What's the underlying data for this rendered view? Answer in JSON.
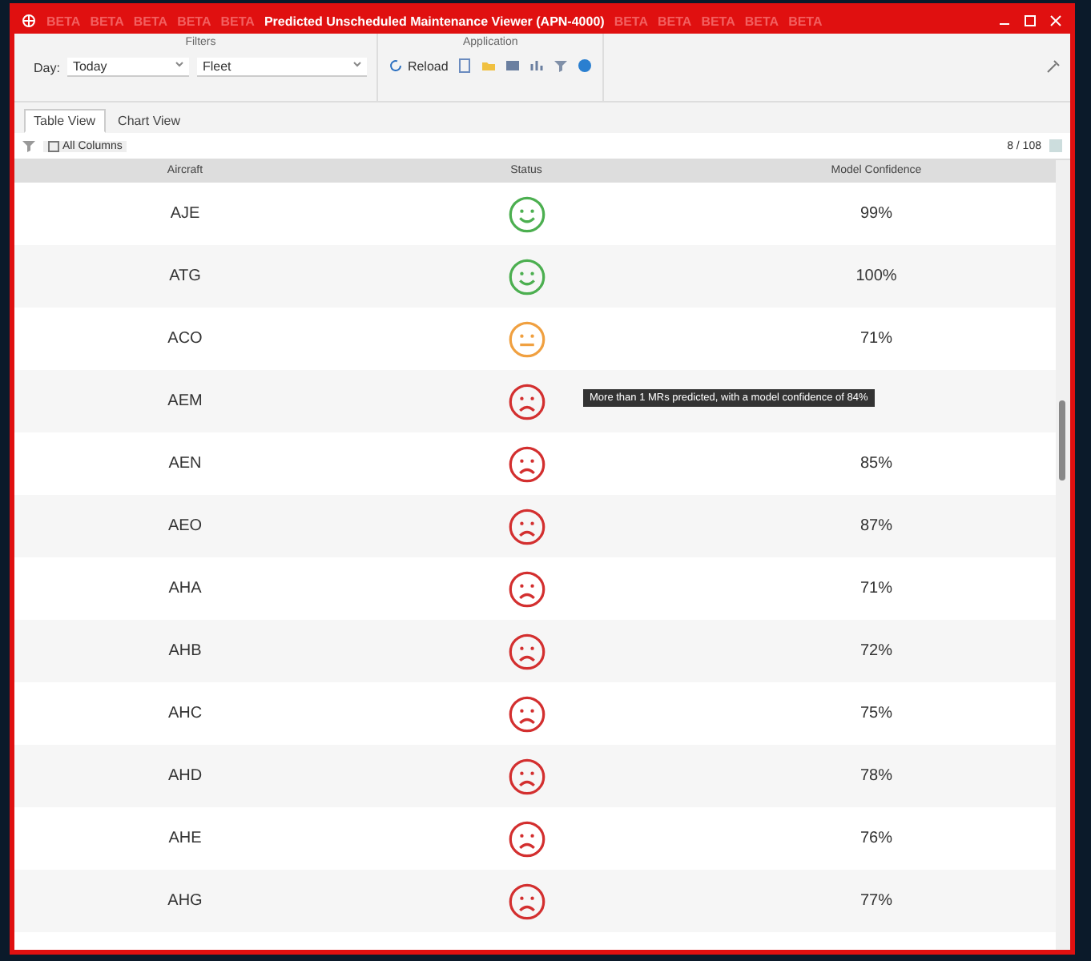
{
  "window": {
    "title": "Predicted Unscheduled Maintenance Viewer (APN-4000)",
    "beta_left": [
      "BETA",
      "BETA",
      "BETA",
      "BETA",
      "BETA"
    ],
    "beta_right": [
      "BETA",
      "BETA",
      "BETA",
      "BETA",
      "BETA"
    ]
  },
  "ribbon": {
    "groups": [
      {
        "label": "Filters"
      },
      {
        "label": "Application"
      }
    ],
    "day_label": "Day:",
    "day_value": "Today",
    "fleet_value": "Fleet",
    "reload_label": "Reload"
  },
  "tabs": [
    {
      "label": "Table View",
      "selected": true
    },
    {
      "label": "Chart View",
      "selected": false
    }
  ],
  "filter_bar": {
    "columns_label": "All Columns",
    "counter": "8 / 108"
  },
  "table": {
    "columns": [
      "Aircraft",
      "Status",
      "Model Confidence"
    ],
    "rows": [
      {
        "aircraft": "AJE",
        "kind": "happy",
        "color": "#4caf50",
        "confidence": "99%"
      },
      {
        "aircraft": "ATG",
        "kind": "happy",
        "color": "#4caf50",
        "confidence": "100%"
      },
      {
        "aircraft": "ACO",
        "kind": "neutral",
        "color": "#f0a040",
        "confidence": "71%"
      },
      {
        "aircraft": "AEM",
        "kind": "sad",
        "color": "#d32f2f",
        "tooltip": "More than 1 MRs predicted, with a model confidence of 84%"
      },
      {
        "aircraft": "AEN",
        "kind": "sad",
        "color": "#d32f2f",
        "confidence": "85%"
      },
      {
        "aircraft": "AEO",
        "kind": "sad",
        "color": "#d32f2f",
        "confidence": "87%"
      },
      {
        "aircraft": "AHA",
        "kind": "sad",
        "color": "#d32f2f",
        "confidence": "71%"
      },
      {
        "aircraft": "AHB",
        "kind": "sad",
        "color": "#d32f2f",
        "confidence": "72%"
      },
      {
        "aircraft": "AHC",
        "kind": "sad",
        "color": "#d32f2f",
        "confidence": "75%"
      },
      {
        "aircraft": "AHD",
        "kind": "sad",
        "color": "#d32f2f",
        "confidence": "78%"
      },
      {
        "aircraft": "AHE",
        "kind": "sad",
        "color": "#d32f2f",
        "confidence": "76%"
      },
      {
        "aircraft": "AHG",
        "kind": "sad",
        "color": "#d32f2f",
        "confidence": "77%"
      }
    ]
  }
}
